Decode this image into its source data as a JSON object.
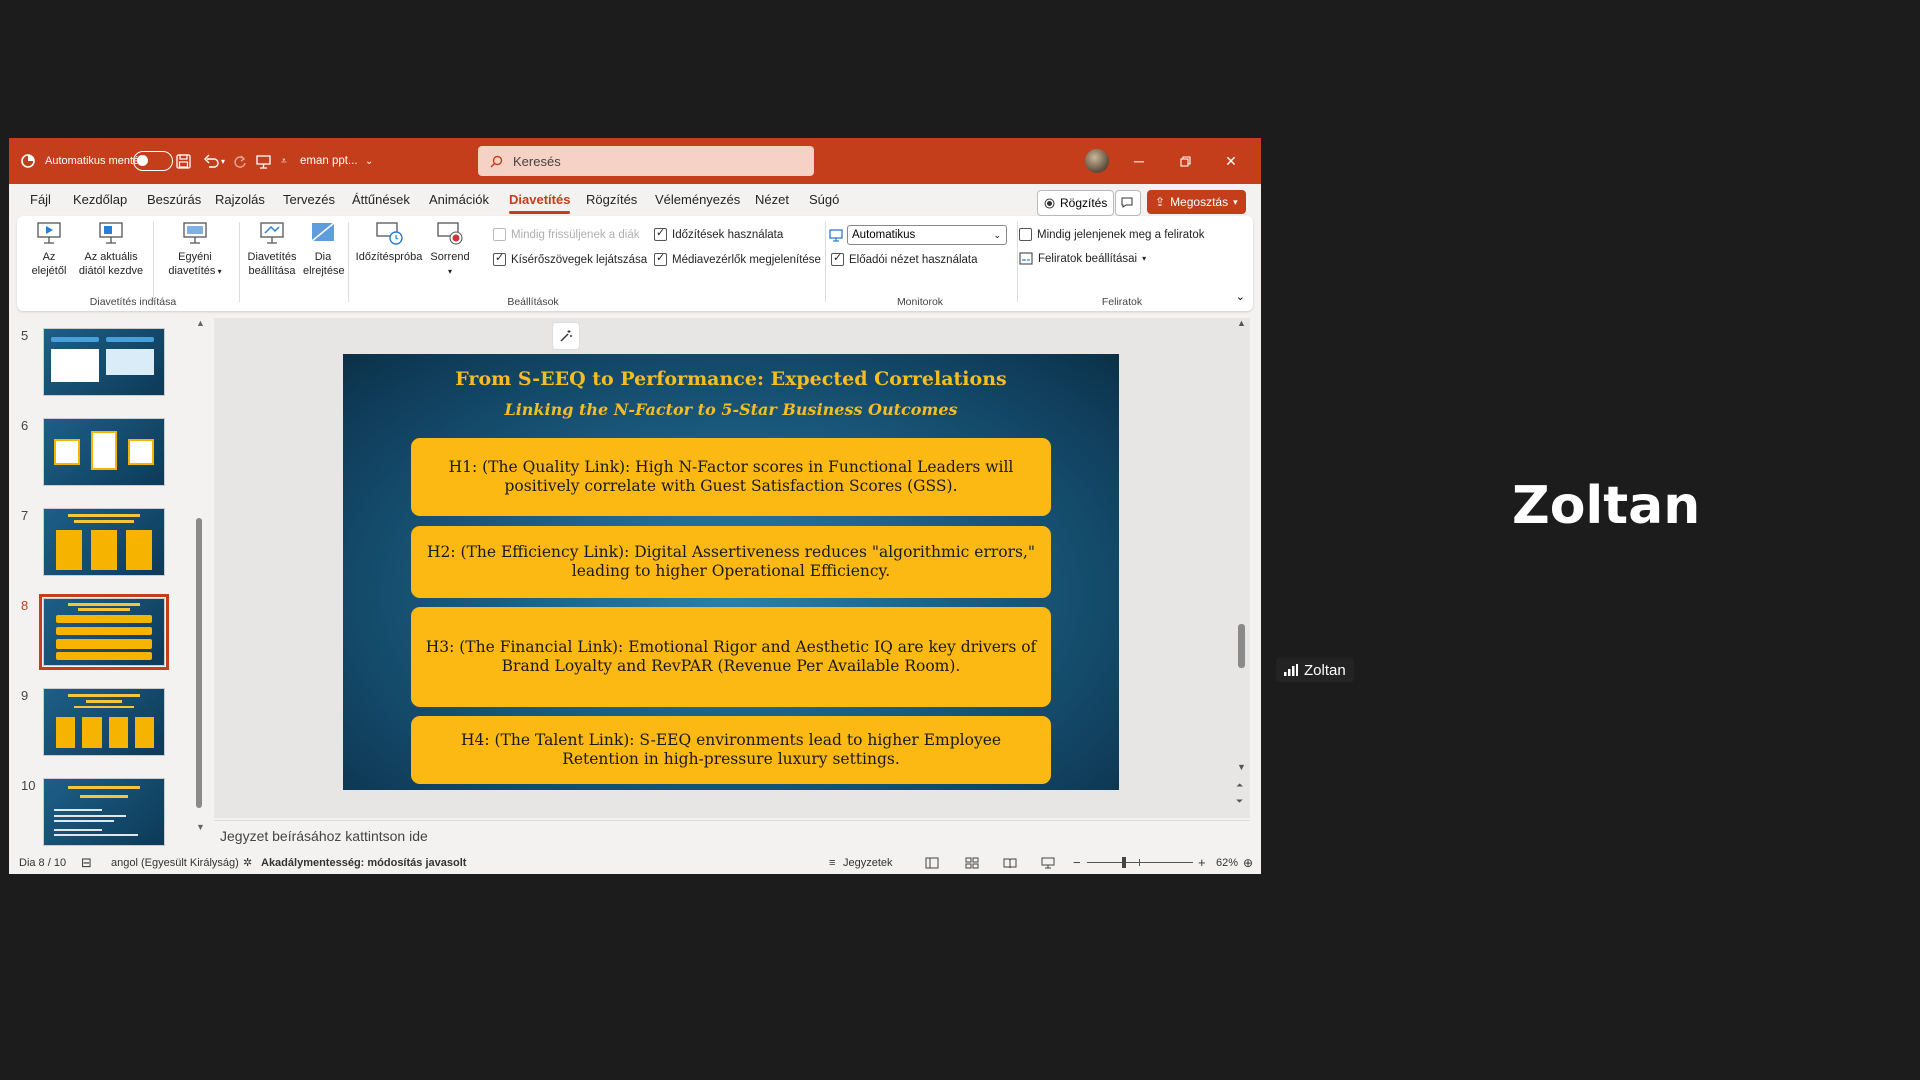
{
  "titlebar": {
    "autosave_label": "Automatikus mentés",
    "filename": "eman ppt...",
    "search_placeholder": "Keresés"
  },
  "menu": {
    "tabs": [
      "Fájl",
      "Kezdőlap",
      "Beszúrás",
      "Rajzolás",
      "Tervezés",
      "Áttűnések",
      "Animációk",
      "Diavetítés",
      "Rögzítés",
      "Véleményezés",
      "Nézet",
      "Súgó"
    ],
    "active_tab": "Diavetítés",
    "record_btn": "Rögzítés",
    "share_btn": "Megosztás"
  },
  "ribbon": {
    "from_start_1": "Az",
    "from_start_2": "elejétől",
    "from_current_1": "Az aktuális",
    "from_current_2": "diától kezdve",
    "custom_1": "Egyéni",
    "custom_2": "diavetítés",
    "group_start": "Diavetítés indítása",
    "setup_1": "Diavetítés",
    "setup_2": "beállítása",
    "hide_1": "Dia",
    "hide_2": "elrejtése",
    "rehearse": "Időzítéspróba",
    "record_1": "Sorrend",
    "opt_refresh": "Mindig frissüljenek a diák",
    "opt_narrations": "Kísérőszövegek lejátszása",
    "opt_timings": "Időzítések használata",
    "opt_media": "Médiavezérlők megjelenítése",
    "group_setup": "Beállítások",
    "monitor_value": "Automatikus",
    "opt_presenter": "Előadói nézet használata",
    "group_monitors": "Monitorok",
    "opt_captions": "Mindig jelenjenek meg a feliratok",
    "caption_settings": "Feliratok beállításai",
    "group_captions": "Feliratok"
  },
  "thumbnails": {
    "numbers": [
      "5",
      "6",
      "7",
      "8",
      "9",
      "10"
    ],
    "active": "8"
  },
  "slide": {
    "title": "From S-EEQ to Performance: Expected Correlations",
    "subtitle": "Linking the N-Factor to 5-Star Business Outcomes",
    "hypotheses": [
      "H1: (The Quality Link): High N-Factor scores in Functional Leaders will positively correlate with Guest Satisfaction Scores (GSS).",
      "H2: (The Efficiency Link): Digital Assertiveness reduces \"algorithmic errors,\" leading to higher Operational Efficiency.",
      "H3: (The Financial Link): Emotional Rigor and Aesthetic IQ are key drivers of Brand Loyalty and RevPAR (Revenue Per Available Room).",
      "H4: (The Talent Link): S-EEQ environments lead to higher Employee Retention in high-pressure luxury settings."
    ]
  },
  "notes_placeholder": "Jegyzet beírásához kattintson ide",
  "status": {
    "slide_counter": "Dia 8 / 10",
    "language": "angol (Egyesült Királyság)",
    "accessibility": "Akadálymentesség: módosítás javasolt",
    "notes_btn": "Jegyzetek",
    "zoom": "62%"
  },
  "participant": {
    "name": "Zoltan",
    "tag": "Zoltan"
  },
  "colors": {
    "accent": "#c43e1c",
    "slide_box": "#fdb913",
    "slide_title": "#f5bd22"
  }
}
